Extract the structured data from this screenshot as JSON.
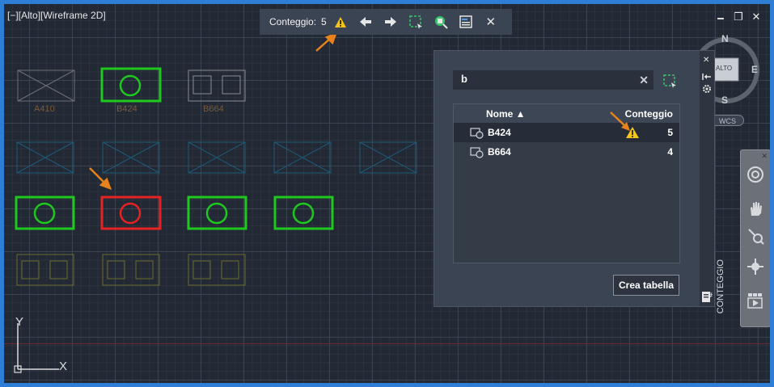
{
  "viewport": {
    "label": "[−][Alto][Wireframe 2D]"
  },
  "window_controls": {
    "minimize": "🗕",
    "restore": "❐",
    "close": "✕"
  },
  "count_toolbar": {
    "label": "Conteggio:",
    "value": "5",
    "icons": [
      "warning-icon",
      "arrow-left-icon",
      "arrow-right-icon",
      "select-area-icon",
      "find-block-icon",
      "insert-field-icon",
      "close-icon"
    ]
  },
  "drawing_labels": {
    "a410": "A410",
    "b424": "B424",
    "b664": "B664"
  },
  "viewcube": {
    "n": "N",
    "e": "E",
    "s": "S",
    "face": "ALTO",
    "wcs": "WCS"
  },
  "ucs": {
    "x": "X",
    "y": "Y"
  },
  "palette": {
    "search_value": "b",
    "columns": {
      "name": "Nome ▲",
      "count": "Conteggio"
    },
    "rows": [
      {
        "name": "B424",
        "count": "5",
        "warning": true
      },
      {
        "name": "B664",
        "count": "4",
        "warning": false
      }
    ],
    "create_table": "Crea tabella",
    "side_title": "CONTEGGIO"
  },
  "colors": {
    "accent": "#2d7ed4",
    "warning": "#f5c518",
    "arrow": "#e8821a",
    "green": "#1ec81e",
    "red": "#e62222"
  }
}
